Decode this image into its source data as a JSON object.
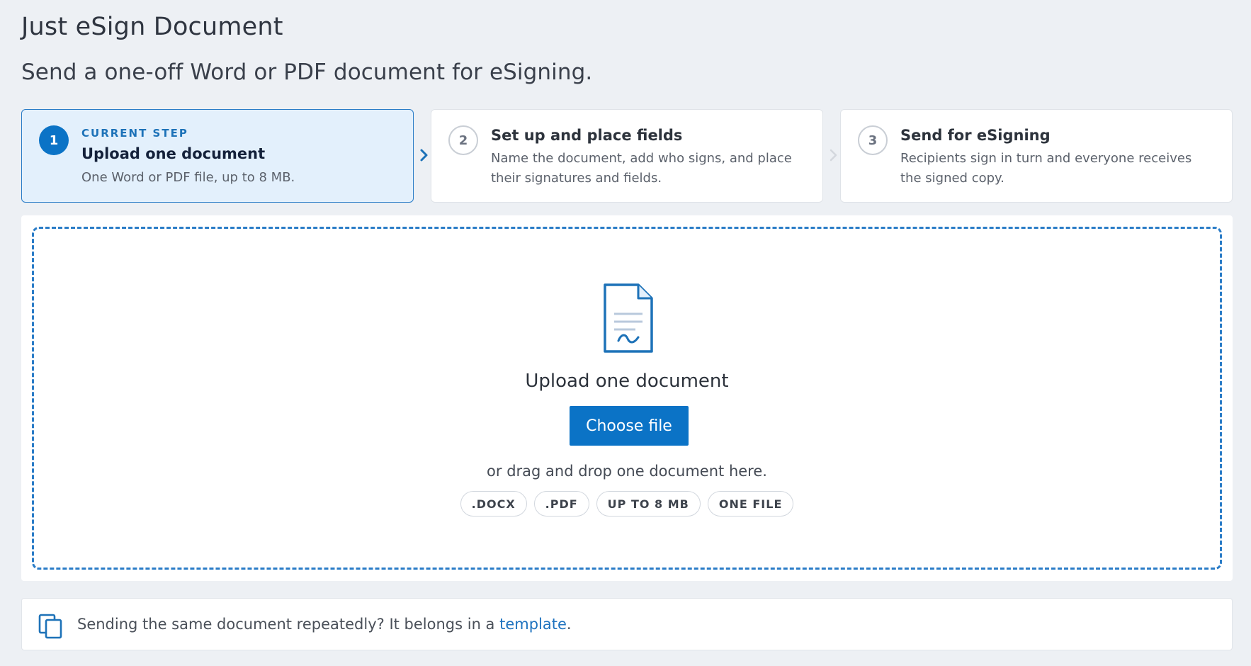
{
  "page": {
    "title": "Just eSign Document",
    "subtitle": "Send a one-off Word or PDF document for eSigning."
  },
  "steps": [
    {
      "number": "1",
      "eyebrow": "CURRENT STEP",
      "title": "Upload one document",
      "description": "One Word or PDF file, up to 8 MB.",
      "state": "current"
    },
    {
      "number": "2",
      "title": "Set up and place fields",
      "description": "Name the document, add who signs, and place their signatures and fields.",
      "state": "pending"
    },
    {
      "number": "3",
      "title": "Send for eSigning",
      "description": "Recipients sign in turn and everyone receives the signed copy.",
      "state": "pending"
    }
  ],
  "upload": {
    "icon": "document-signature-icon",
    "title": "Upload one document",
    "button_label": "Choose file",
    "drag_text": "or drag and drop one document here.",
    "chips": [
      ".DOCX",
      ".PDF",
      "UP TO 8 MB",
      "ONE FILE"
    ]
  },
  "tip": {
    "icon": "copy-icon",
    "text_before": "Sending the same document repeatedly? It belongs in a ",
    "link_text": "template",
    "text_after": "."
  },
  "colors": {
    "accent": "#0b73c6",
    "link": "#1f73bf",
    "current_step_bg": "#e3f0fc",
    "page_bg": "#edf0f4"
  }
}
